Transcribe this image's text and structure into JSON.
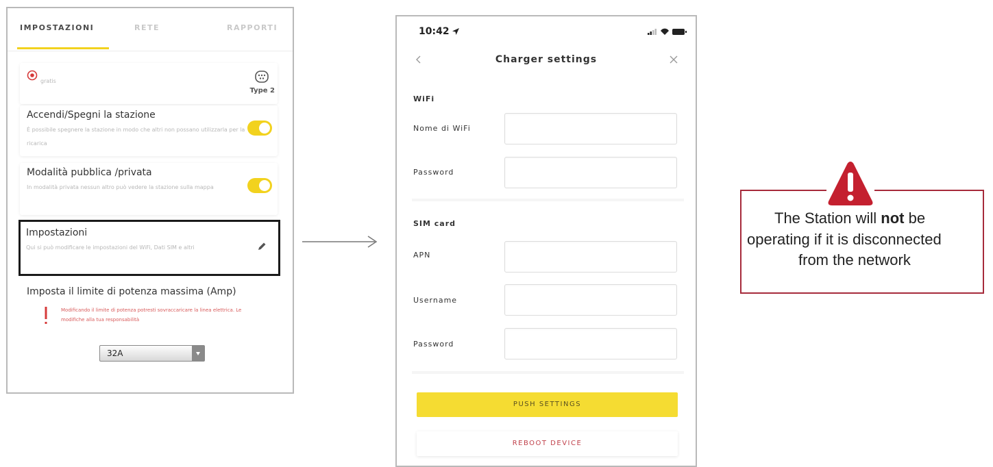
{
  "left_screen": {
    "tabs": [
      {
        "label": "IMPOSTAZIONI",
        "active": true
      },
      {
        "label": "RETE",
        "active": false
      },
      {
        "label": "RAPPORTI",
        "active": false
      }
    ],
    "accent_color": "#f2d21e",
    "connector": {
      "status_text": "gratis",
      "type_label": "Type 2"
    },
    "station_toggle": {
      "title": "Accendi/Spegni la stazione",
      "description": "È possibile spegnere la stazione in modo che altri non possano utilizzarla per la ricarica",
      "on": true
    },
    "public_private": {
      "title": "Modalità pubblica  /privata",
      "description": "In modalità privata nessun altro può vedere la stazione sulla mappa",
      "on": true
    },
    "settings_item": {
      "title": "Impostazioni",
      "description": "Qui si può modificare le impostazioni del WiFi, Dati SIM e altri"
    },
    "power_limit": {
      "title": "Imposta il limite di potenza massima (Amp)",
      "warning": "Modificando il limite di potenza potresti sovraccaricare la linea elettrica. Le modifiche alla tua responsabilità",
      "selected_value": "32A"
    }
  },
  "right_screen": {
    "status_time": "10:42",
    "title": "Charger settings",
    "wifi_section": "WiFi",
    "wifi_fields": [
      {
        "label": "Nome di WiFi",
        "value": ""
      },
      {
        "label": "Password",
        "value": ""
      }
    ],
    "sim_section": "SIM card",
    "sim_fields": [
      {
        "label": "APN",
        "value": ""
      },
      {
        "label": "Username",
        "value": ""
      },
      {
        "label": "Password",
        "value": ""
      }
    ],
    "push_button": "PUSH SETTINGS",
    "reboot_button": "REBOOT DEVICE",
    "push_color": "#f5dc32",
    "reboot_color": "#c0404a"
  },
  "warning": {
    "line1_prefix": "The Station will ",
    "line1_bold": "not",
    "line1_suffix": " be",
    "line2": "operating if it is disconnected",
    "line3": "from the network",
    "border_color": "#a62a3a",
    "icon_color": "#c4202f"
  }
}
